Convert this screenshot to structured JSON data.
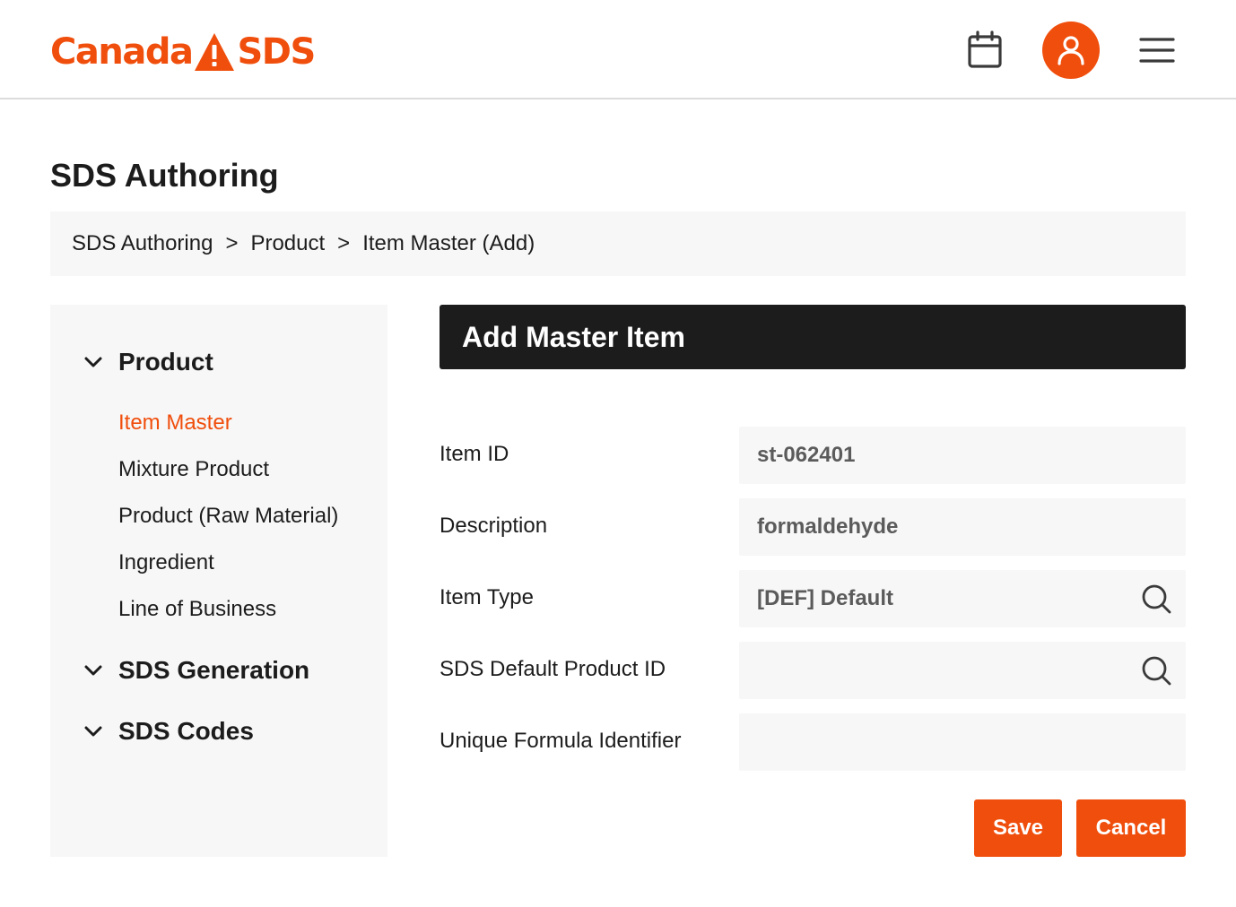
{
  "brand": {
    "name_left": "Canada",
    "name_right": "SDS",
    "accent_color": "#f04e0c",
    "logo_icon": "warning-triangle-icon"
  },
  "header": {
    "icons": [
      "calendar-icon",
      "user-icon",
      "hamburger-menu-icon"
    ]
  },
  "page": {
    "title": "SDS Authoring"
  },
  "breadcrumb": {
    "items": [
      "SDS Authoring",
      "Product",
      "Item Master (Add)"
    ],
    "separator": ">"
  },
  "sidebar": {
    "groups": [
      {
        "label": "Product",
        "expanded": true,
        "items": [
          "Item Master",
          "Mixture Product",
          "Product (Raw Material)",
          "Ingredient",
          "Line of Business"
        ],
        "active_index": 0
      },
      {
        "label": "SDS Generation",
        "expanded": false,
        "items": []
      },
      {
        "label": "SDS Codes",
        "expanded": false,
        "items": []
      }
    ]
  },
  "form": {
    "title": "Add Master Item",
    "fields": [
      {
        "label": "Item ID",
        "value": "st-062401",
        "lookup": false
      },
      {
        "label": "Description",
        "value": "formaldehyde",
        "lookup": false
      },
      {
        "label": "Item Type",
        "value": "[DEF] Default",
        "lookup": true
      },
      {
        "label": "SDS Default Product ID",
        "value": "",
        "lookup": true
      },
      {
        "label": "Unique Formula Identifier",
        "value": "",
        "lookup": false
      }
    ],
    "save_label": "Save",
    "cancel_label": "Cancel"
  }
}
